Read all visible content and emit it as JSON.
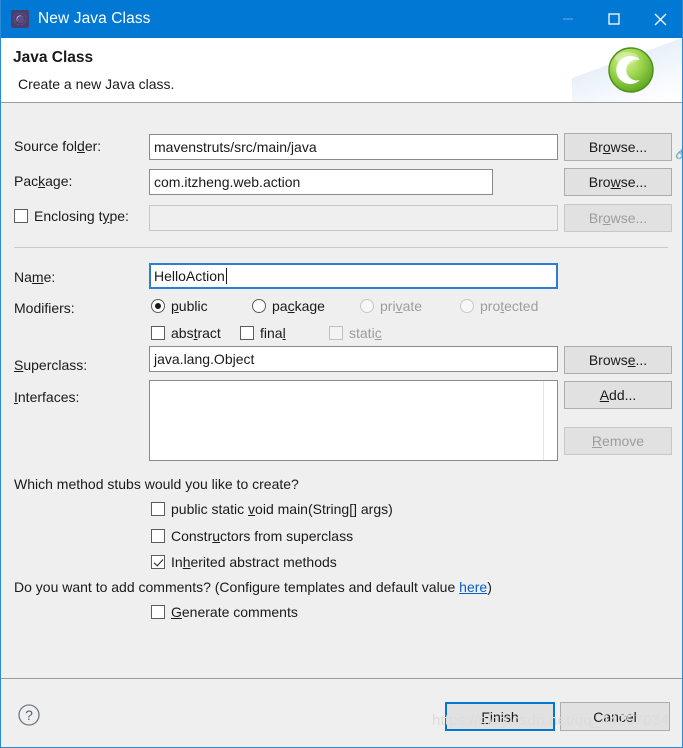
{
  "window": {
    "title": "New Java Class",
    "icon": "eclipse-icon",
    "controls": {
      "minimize": "minimize-icon",
      "maximize": "maximize-icon",
      "close": "close-icon"
    }
  },
  "header": {
    "title": "Java Class",
    "subtitle": "Create a new Java class.",
    "icon": "java-class-icon"
  },
  "form": {
    "source_folder": {
      "label": "Source folder:",
      "value": "mavenstruts/src/main/java",
      "browse": "Browse..."
    },
    "package": {
      "label": "Package:",
      "value": "com.itzheng.web.action",
      "browse": "Browse..."
    },
    "enclosing_type": {
      "label": "Enclosing type:",
      "value": "",
      "checked": false,
      "enabled": false,
      "browse": "Browse..."
    },
    "name": {
      "label": "Name:",
      "value": "HelloAction"
    },
    "modifiers": {
      "label": "Modifiers:",
      "access": [
        {
          "label": "public",
          "selected": true,
          "enabled": true
        },
        {
          "label": "package",
          "selected": false,
          "enabled": true
        },
        {
          "label": "private",
          "selected": false,
          "enabled": false
        },
        {
          "label": "protected",
          "selected": false,
          "enabled": false
        }
      ],
      "flags": [
        {
          "label": "abstract",
          "checked": false,
          "enabled": true
        },
        {
          "label": "final",
          "checked": false,
          "enabled": true
        },
        {
          "label": "static",
          "checked": false,
          "enabled": false
        }
      ]
    },
    "superclass": {
      "label": "Superclass:",
      "value": "java.lang.Object",
      "browse": "Browse..."
    },
    "interfaces": {
      "label": "Interfaces:",
      "items": [],
      "add": "Add...",
      "remove": "Remove"
    },
    "stubs": {
      "question": "Which method stubs would you like to create?",
      "options": [
        {
          "label": "public static void main(String[] args)",
          "checked": false
        },
        {
          "label": "Constructors from superclass",
          "checked": false
        },
        {
          "label": "Inherited abstract methods",
          "checked": true
        }
      ]
    },
    "comments": {
      "question_before": "Do you want to add comments? (Configure templates and default value ",
      "link": "here",
      "question_after": ")",
      "option": {
        "label": "Generate comments",
        "checked": false
      }
    }
  },
  "footer": {
    "help": "help-icon",
    "finish": "Finish",
    "cancel": "Cancel"
  },
  "watermark": "https://blog.csdn.net/qq_44757034",
  "colors": {
    "titlebar": "#0078d4",
    "dialog_bg": "#efeff0",
    "accent": "#0078d4",
    "link": "#0b5fbf",
    "java_icon_green": "#7ac943"
  }
}
